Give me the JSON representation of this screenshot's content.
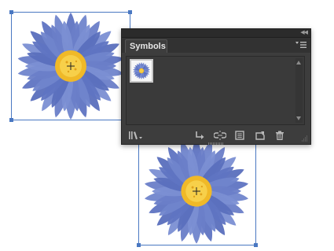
{
  "panel": {
    "tab_label": "Symbols",
    "collapse_icon": "double-chevron-left-icon",
    "menu_icon": "panel-menu-icon"
  },
  "symbols": [
    {
      "name": "blue-aster-flower",
      "selected": true
    }
  ],
  "toolbar": {
    "icons": [
      "symbol-libraries-menu-icon",
      "place-symbol-instance-icon",
      "break-link-icon",
      "symbol-options-icon",
      "new-symbol-icon",
      "delete-symbol-icon"
    ]
  },
  "colors": {
    "panel_bg": "#3d3d3d",
    "selection": "#4a78c2",
    "petal": "#6b7fc8",
    "center": "#f2c230"
  }
}
